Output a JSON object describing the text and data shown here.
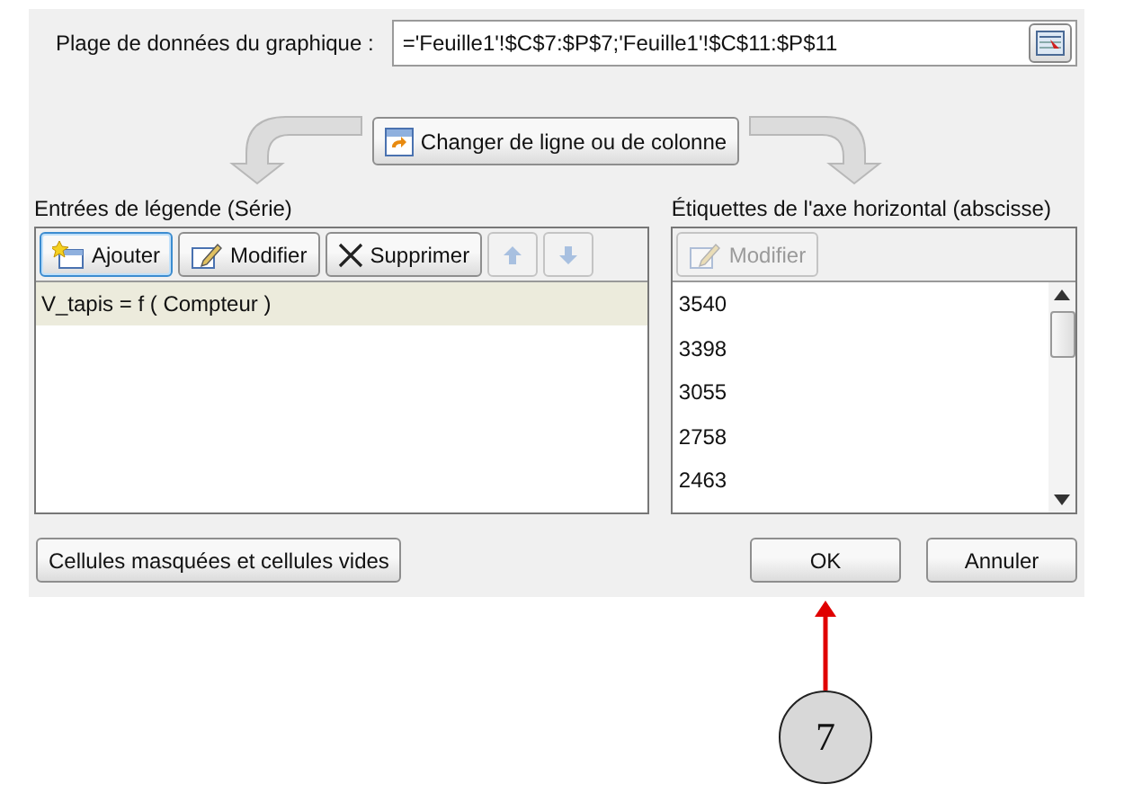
{
  "data_range": {
    "label": "Plage de données du graphique :",
    "value": "='Feuille1'!$C$7:$P$7;'Feuille1'!$C$11:$P$11"
  },
  "switch_button": {
    "label": "Changer de ligne ou de colonne"
  },
  "series_panel": {
    "title": "Entrées de légende (Série)",
    "buttons": [
      {
        "label": "Ajouter",
        "kind": "add",
        "disabled": false
      },
      {
        "label": "Modifier",
        "kind": "edit",
        "disabled": false
      },
      {
        "label": "Supprimer",
        "kind": "delete",
        "disabled": false
      },
      {
        "kind": "up",
        "disabled": true
      },
      {
        "kind": "down",
        "disabled": true
      }
    ],
    "items": [
      {
        "label": "V_tapis = f ( Compteur )",
        "selected": true
      }
    ]
  },
  "axis_panel": {
    "title": "Étiquettes de l'axe horizontal (abscisse)",
    "buttons": [
      {
        "label": "Modifier",
        "kind": "edit",
        "disabled": true
      }
    ],
    "items": [
      "3540",
      "3398",
      "3055",
      "2758",
      "2463"
    ]
  },
  "hidden_cells_button": {
    "label": "Cellules masquées et cellules vides"
  },
  "ok_button": {
    "label": "OK"
  },
  "cancel_button": {
    "label": "Annuler"
  },
  "callout": {
    "number": "7"
  }
}
